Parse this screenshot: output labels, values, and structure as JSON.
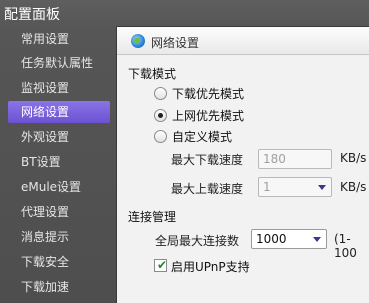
{
  "window": {
    "title": "配置面板"
  },
  "sidebar": {
    "items": [
      {
        "label": "常用设置"
      },
      {
        "label": "任务默认属性"
      },
      {
        "label": "监视设置"
      },
      {
        "label": "网络设置"
      },
      {
        "label": "外观设置"
      },
      {
        "label": "BT设置"
      },
      {
        "label": "eMule设置"
      },
      {
        "label": "代理设置"
      },
      {
        "label": "消息提示"
      },
      {
        "label": "下载安全"
      },
      {
        "label": "下载加速"
      }
    ],
    "active": "网络设置"
  },
  "panel": {
    "header": {
      "label": "网络设置",
      "icon": "globe-icon"
    },
    "download_mode": {
      "title": "下载模式",
      "options": [
        {
          "label": "下载优先模式",
          "checked": false
        },
        {
          "label": "上网优先模式",
          "checked": true
        },
        {
          "label": "自定义模式",
          "checked": false
        }
      ],
      "max_download": {
        "label": "最大下载速度",
        "value": "180",
        "unit": "KB/s"
      },
      "max_upload": {
        "label": "最大上载速度",
        "value": "1",
        "unit": "KB/s"
      }
    },
    "connection": {
      "title": "连接管理",
      "max_connections": {
        "label": "全局最大连接数",
        "value": "1000",
        "range_hint": "(1-100"
      },
      "upnp": {
        "label": "启用UPnP支持",
        "checked": true
      }
    }
  },
  "colors": {
    "sidebar_bg": "#565656",
    "active_item": "#7a62de",
    "panel_bg": "#f2f2f2"
  }
}
